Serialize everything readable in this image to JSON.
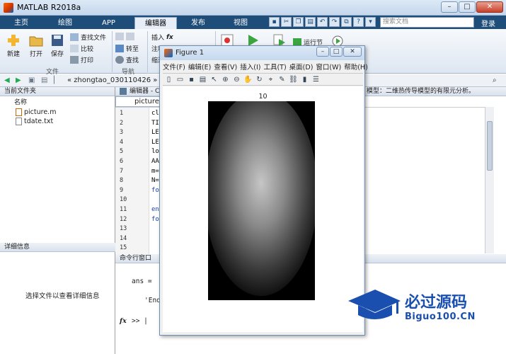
{
  "app": {
    "title": "MATLAB R2018a"
  },
  "ribbon_tabs": [
    "主页",
    "绘图",
    "APP",
    "编辑器",
    "发布",
    "视图"
  ],
  "search": {
    "placeholder": "搜索文档"
  },
  "login": "登录",
  "ribbon": {
    "new": "新建",
    "open": "打开",
    "save": "保存",
    "find_files": "查找文件",
    "compare": "比较",
    "print": "打印",
    "goto": "转至",
    "find": "查找",
    "insert": "插入",
    "comment": "注释",
    "indent": "缩进",
    "run_section": "运行节",
    "group_file": "文件",
    "group_nav": "导航"
  },
  "address": {
    "path": "«  zhongtao_030110426  »  mat"
  },
  "left_panel": {
    "header": "当前文件夹",
    "column": "名称",
    "files": [
      "picture.m",
      "tdate.txt"
    ],
    "detail_header": "详细信息",
    "detail_text": "选择文件以查看详细信息"
  },
  "editor": {
    "header": "编辑器 - C",
    "header_right": "模型：二维热传导模型的有限元分析。",
    "tab": "picture.m",
    "line_numbers": [
      "1",
      "2",
      "3",
      "4",
      "5",
      "6",
      "7",
      "8",
      "9",
      "10",
      "11",
      "12",
      "13",
      "14",
      "15"
    ],
    "lines": [
      "cl",
      "TI",
      "LE",
      "LE",
      "lo",
      "AA",
      "m=",
      "N=",
      "fo",
      "",
      "en",
      "fo",
      "",
      "",
      ""
    ]
  },
  "command_window": {
    "header": "命令行窗口",
    "line1": "ans =",
    "line2": "'End",
    "prompt": ">> |",
    "fx": "fx"
  },
  "figure": {
    "title": "Figure 1",
    "menu": [
      "文件(F)",
      "编辑(E)",
      "查看(V)",
      "插入(I)",
      "工具(T)",
      "桌面(D)",
      "窗口(W)",
      "帮助(H)"
    ],
    "axis_title": "10"
  },
  "watermark": {
    "cn": "必过源码",
    "en": "Biguo100.CN"
  },
  "colors": {
    "tabbar": "#1f4d7a",
    "accent": "#1a4fb0"
  }
}
